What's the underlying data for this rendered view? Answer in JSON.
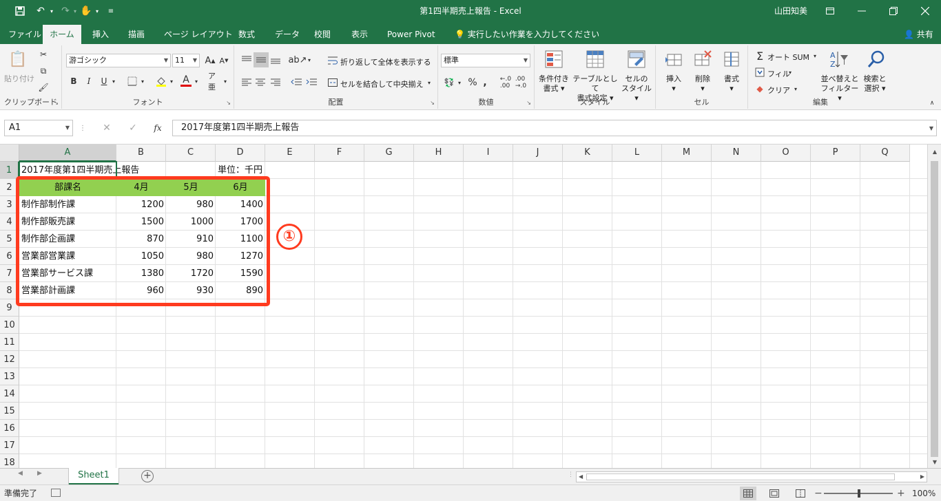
{
  "window": {
    "title": "第1四半期売上報告  -  Excel",
    "user": "山田知美"
  },
  "tabs": [
    "ファイル",
    "ホーム",
    "挿入",
    "描画",
    "ページ レイアウト",
    "数式",
    "データ",
    "校閲",
    "表示",
    "Power Pivot"
  ],
  "active_tab": "ホーム",
  "tell_me": "実行したい作業を入力してください",
  "share": "共有",
  "ribbon": {
    "clipboard": {
      "label": "クリップボード",
      "paste": "貼り付け"
    },
    "font": {
      "label": "フォント",
      "name": "游ゴシック",
      "size": "11",
      "bold": "B",
      "italic": "I",
      "underline": "U"
    },
    "alignment": {
      "label": "配置",
      "wrap": "折り返して全体を表示する",
      "merge": "セルを結合して中央揃え"
    },
    "number": {
      "label": "数値",
      "format": "標準"
    },
    "styles": {
      "label": "スタイル",
      "conditional_1": "条件付き",
      "conditional_2": "書式",
      "table_1": "テーブルとして",
      "table_2": "書式設定",
      "cell_1": "セルの",
      "cell_2": "スタイル"
    },
    "cells": {
      "label": "セル",
      "insert": "挿入",
      "delete": "削除",
      "format": "書式"
    },
    "editing": {
      "label": "編集",
      "autosum": "オート SUM",
      "fill": "フィル",
      "clear": "クリア",
      "sort_1": "並べ替えと",
      "sort_2": "フィルター",
      "find_1": "検索と",
      "find_2": "選択"
    }
  },
  "formula_bar": {
    "name_box": "A1",
    "fx": "fx",
    "content": "2017年度第1四半期売上報告"
  },
  "columns": [
    "A",
    "B",
    "C",
    "D",
    "E",
    "F",
    "G",
    "H",
    "I",
    "J",
    "K",
    "L",
    "M",
    "N",
    "O",
    "P",
    "Q"
  ],
  "rows": [
    "1",
    "2",
    "3",
    "4",
    "5",
    "6",
    "7",
    "8",
    "9",
    "10",
    "11",
    "12",
    "13",
    "14",
    "15",
    "16",
    "17",
    "18"
  ],
  "sheet": {
    "title_cell": "2017年度第1四半期売上報告",
    "unit_cell": "単位：千円",
    "header": [
      "部課名",
      "4月",
      "5月",
      "6月"
    ],
    "data": [
      [
        "制作部制作課",
        "1200",
        "980",
        "1400"
      ],
      [
        "制作部販売課",
        "1500",
        "1000",
        "1700"
      ],
      [
        "制作部企画課",
        "870",
        "910",
        "1100"
      ],
      [
        "営業部営業課",
        "1050",
        "980",
        "1270"
      ],
      [
        "営業部サービス課",
        "1380",
        "1720",
        "1590"
      ],
      [
        "営業部計画課",
        "960",
        "930",
        "890"
      ]
    ]
  },
  "annotation": "①",
  "sheet_tab": "Sheet1",
  "status": {
    "ready": "準備完了",
    "zoom": "100%",
    "minus": "−",
    "plus": "+"
  },
  "colors": {
    "accent": "#217346",
    "header_fill": "#92d050",
    "highlight": "#ff3b1f"
  }
}
